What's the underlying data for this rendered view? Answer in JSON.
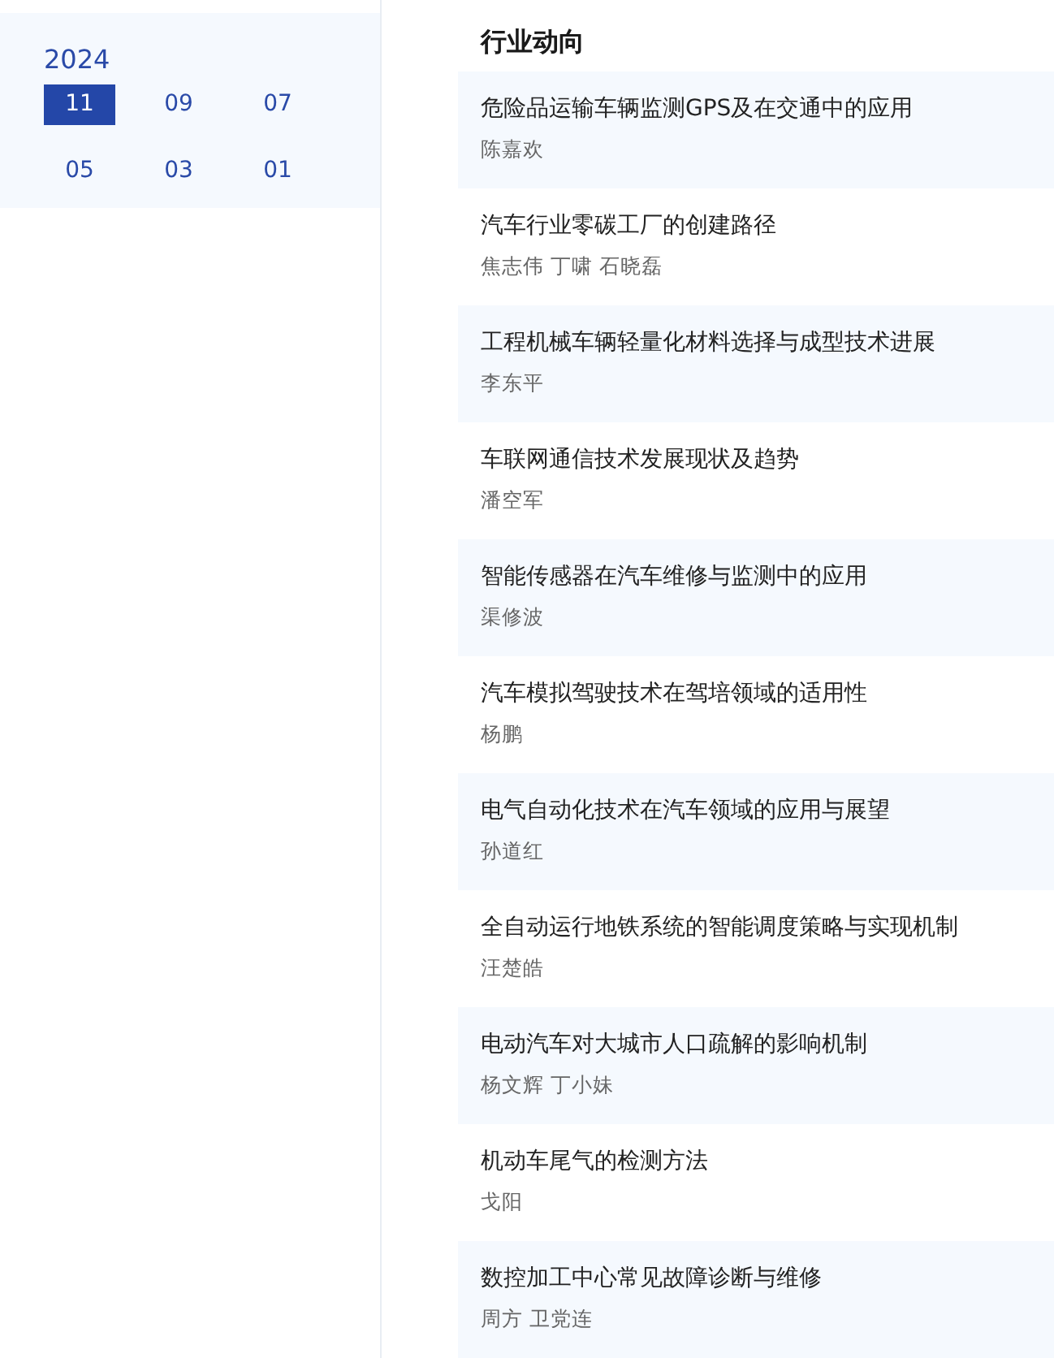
{
  "archive": {
    "year": "2024",
    "months": [
      {
        "label": "11",
        "selected": true
      },
      {
        "label": "09",
        "selected": false
      },
      {
        "label": "07",
        "selected": false
      },
      {
        "label": "05",
        "selected": false
      },
      {
        "label": "03",
        "selected": false
      },
      {
        "label": "01",
        "selected": false
      }
    ]
  },
  "section": {
    "title": "行业动向",
    "articles": [
      {
        "title": "危险品运输车辆监测GPS及在交通中的应用",
        "authors": "陈嘉欢"
      },
      {
        "title": "汽车行业零碳工厂的创建路径",
        "authors": "焦志伟 丁啸 石晓磊"
      },
      {
        "title": "工程机械车辆轻量化材料选择与成型技术进展",
        "authors": "李东平"
      },
      {
        "title": "车联网通信技术发展现状及趋势",
        "authors": "潘空军"
      },
      {
        "title": "智能传感器在汽车维修与监测中的应用",
        "authors": "渠修波"
      },
      {
        "title": "汽车模拟驾驶技术在驾培领域的适用性",
        "authors": "杨鹏"
      },
      {
        "title": "电气自动化技术在汽车领域的应用与展望",
        "authors": "孙道红"
      },
      {
        "title": "全自动运行地铁系统的智能调度策略与实现机制",
        "authors": "汪楚皓"
      },
      {
        "title": "电动汽车对大城市人口疏解的影响机制",
        "authors": "杨文辉 丁小妹"
      },
      {
        "title": "机动车尾气的检测方法",
        "authors": "戈阳"
      },
      {
        "title": "数控加工中心常见故障诊断与维修",
        "authors": "周方 卫党连"
      }
    ]
  }
}
